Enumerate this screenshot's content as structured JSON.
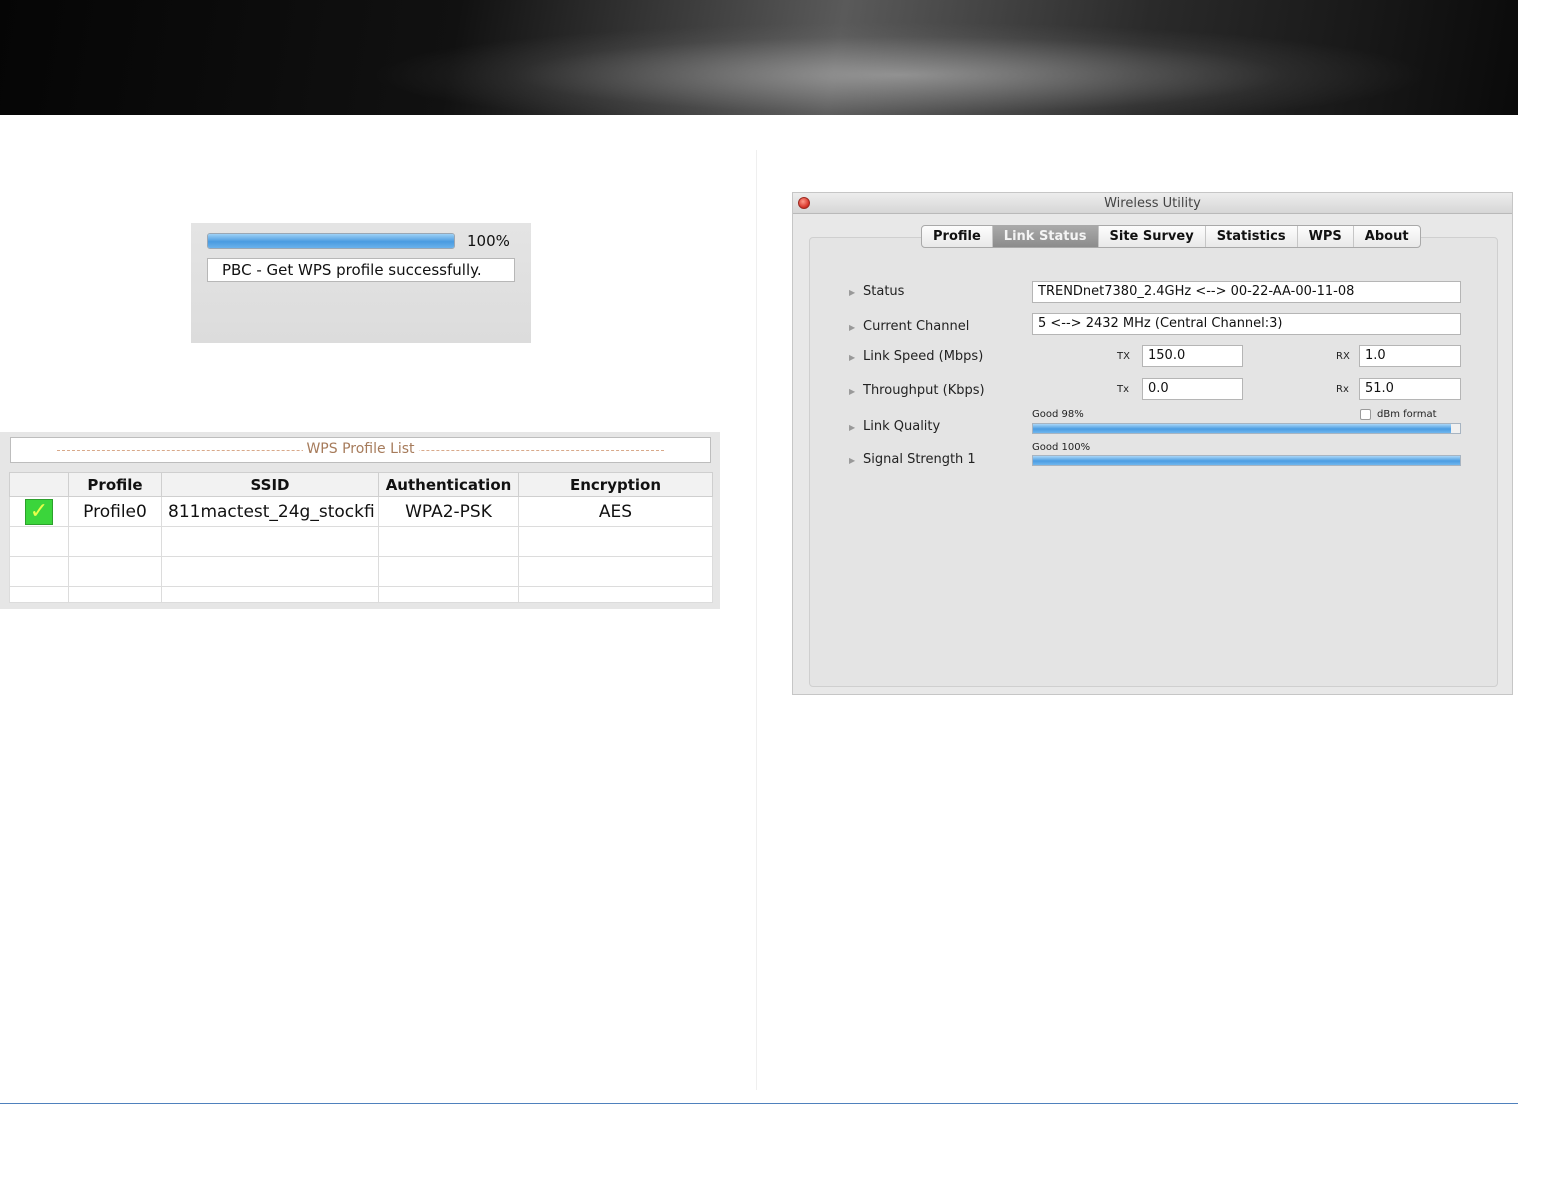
{
  "progress_dialog": {
    "progress_percent_value": 100,
    "progress_text": "100%",
    "message": "PBC - Get WPS profile successfully."
  },
  "wps_profile_list": {
    "title": "WPS Profile List",
    "columns": [
      "",
      "Profile",
      "SSID",
      "Authentication",
      "Encryption"
    ],
    "rows": [
      {
        "selected": true,
        "profile": "Profile0",
        "ssid": "811mactest_24g_stockfi",
        "authentication": "WPA2-PSK",
        "encryption": "AES"
      }
    ],
    "check_icon": "checkmark-icon"
  },
  "wireless_utility": {
    "window_title": "Wireless Utility",
    "tabs": [
      "Profile",
      "Link Status",
      "Site Survey",
      "Statistics",
      "WPS",
      "About"
    ],
    "active_tab": "Link Status",
    "status_label": "Status",
    "status_value": "TRENDnet7380_2.4GHz <--> 00-22-AA-00-11-08",
    "channel_label": "Current Channel",
    "channel_value": "5 <--> 2432 MHz (Central Channel:3)",
    "link_speed_label": "Link Speed (Mbps)",
    "link_speed_tx_label": "TX",
    "link_speed_tx": "150.0",
    "link_speed_rx_label": "RX",
    "link_speed_rx": "1.0",
    "throughput_label": "Throughput (Kbps)",
    "throughput_tx_label": "Tx",
    "throughput_tx": "0.0",
    "throughput_rx_label": "Rx",
    "throughput_rx": "51.0",
    "link_quality_label": "Link Quality",
    "link_quality_caption": "Good 98%",
    "link_quality_value": 98,
    "dbm_format_label": "dBm format",
    "dbm_format_checked": false,
    "signal_label": "Signal Strength 1",
    "signal_caption": "Good 100%",
    "signal_value": 100
  },
  "colors": {
    "footer_rule": "#4f81bd",
    "progress_blue": "#4a9be0",
    "check_green": "#3bd53b"
  }
}
